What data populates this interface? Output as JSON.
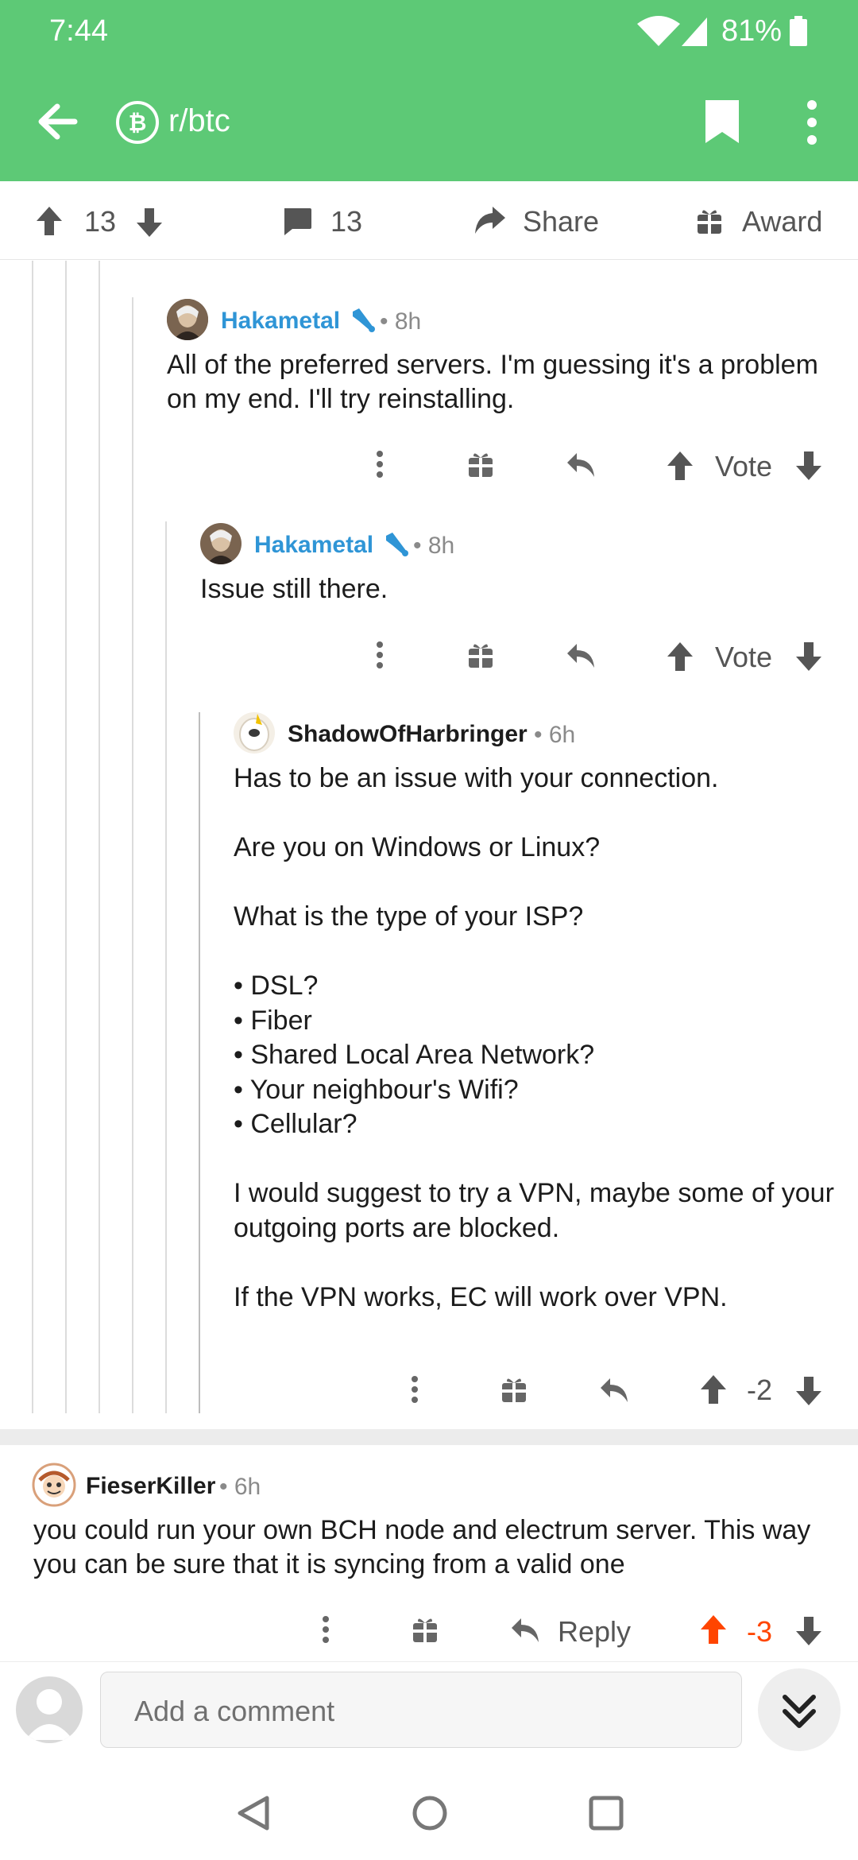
{
  "status": {
    "time": "7:44",
    "battery": "81%"
  },
  "appbar": {
    "subreddit": "r/btc"
  },
  "post_actions": {
    "score": "13",
    "comments": "13",
    "share_label": "Share",
    "award_label": "Award"
  },
  "comments": [
    {
      "author": "Hakametal",
      "age": "• 8h",
      "body": "All of the preferred servers. I'm guessing it's a problem on my end. I'll try reinstalling.",
      "vote": "Vote"
    },
    {
      "author": "Hakametal",
      "age": "• 8h",
      "body": "Issue still there.",
      "vote": "Vote"
    },
    {
      "author": "ShadowOfHarbringer",
      "age": "• 6h",
      "body": "Has to be an issue with your connection.\n\nAre you on Windows or Linux?\n\nWhat is the type of your ISP?\n\n• DSL?\n• Fiber\n• Shared Local Area Network?\n• Your neighbour's Wifi?\n• Cellular?\n\nI would suggest to try a VPN, maybe some of your outgoing ports are blocked.\n\nIf the VPN works, EC will work over VPN.",
      "vote": "-2"
    },
    {
      "author": "FieserKiller",
      "age": "• 6h",
      "body": "you could run your own BCH node and electrum server. This way you can be sure that it is syncing from a valid one",
      "reply": "Reply",
      "vote": "-3"
    }
  ],
  "composer": {
    "placeholder": "Add a comment"
  },
  "colors": {
    "appbar": "#5dc976",
    "username": "#2f95d6",
    "upvoted": "#ff4500"
  }
}
